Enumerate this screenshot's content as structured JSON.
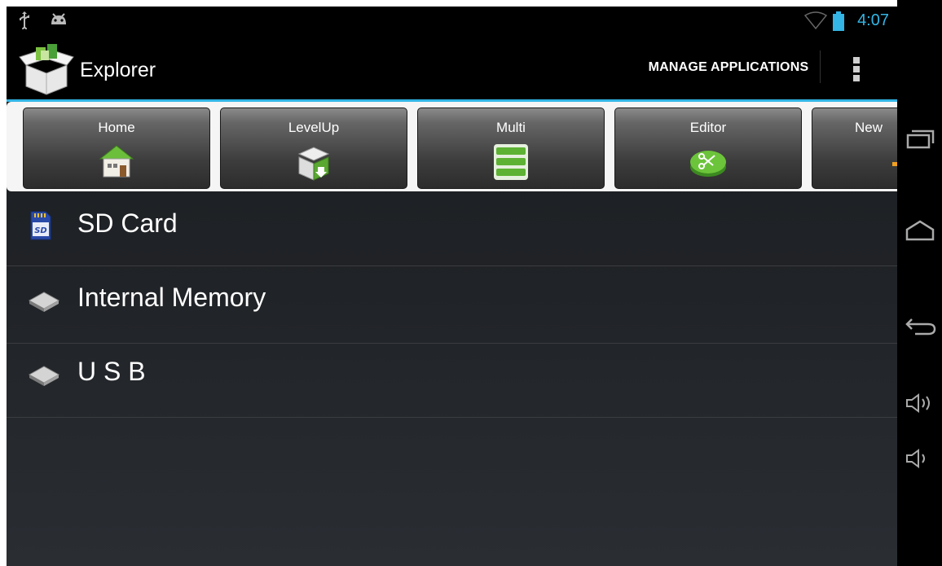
{
  "status_bar": {
    "left_icons": [
      "usb-icon",
      "android-debug-icon"
    ],
    "right_icons": [
      "wifi-icon",
      "battery-icon"
    ],
    "time": "4:07"
  },
  "action_bar": {
    "title": "Explorer",
    "manage_label": "MANAGE APPLICATIONS",
    "accent": "#33b5e5"
  },
  "toolbar": {
    "items": [
      {
        "label": "Home",
        "icon": "home-icon"
      },
      {
        "label": "LevelUp",
        "icon": "level-up-icon"
      },
      {
        "label": "Multi",
        "icon": "multi-select-icon"
      },
      {
        "label": "Editor",
        "icon": "editor-icon"
      },
      {
        "label": "New",
        "icon": "new-icon"
      }
    ]
  },
  "storage_list": [
    {
      "label": "SD Card",
      "icon": "sd-card-icon"
    },
    {
      "label": "Internal Memory",
      "icon": "drive-icon"
    },
    {
      "label": "U S B",
      "icon": "drive-icon"
    }
  ],
  "nav_bar": [
    "recent-apps-icon",
    "home-nav-icon",
    "back-icon",
    "volume-up-icon",
    "volume-down-icon"
  ]
}
